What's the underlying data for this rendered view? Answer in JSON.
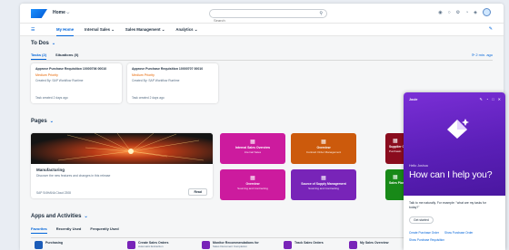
{
  "shell": {
    "title": "Home",
    "search_placeholder": "Search",
    "search_icon": "search-icon",
    "icons": [
      "notification-icon",
      "help-icon",
      "settings-icon",
      "history-icon",
      "joule-icon"
    ]
  },
  "nav": {
    "menu_icon": "menu-icon",
    "tabs": [
      {
        "label": "My Home",
        "active": true
      },
      {
        "label": "Internal Sales"
      },
      {
        "label": "Sales Management"
      },
      {
        "label": "Analytics"
      }
    ]
  },
  "todos": {
    "title": "To Dos",
    "tabs": [
      {
        "label": "Tasks (2)",
        "active": true
      },
      {
        "label": "Situations (0)"
      }
    ],
    "updated": "2 min. ago",
    "cards": [
      {
        "title": "Approve Purchase Requisition 10000706 00010",
        "priority": "Medium Priority",
        "created": "Created By: SAP Workflow Runtime",
        "date": "Task created 2 days ago"
      },
      {
        "title": "Approve Purchase Requisition 10000707 00010",
        "priority": "Medium Priority",
        "created": "Created By: SAP Workflow Runtime",
        "date": "Task created 2 days ago"
      }
    ]
  },
  "pages": {
    "title": "Pages",
    "manufacturing": {
      "title": "Manufacturing",
      "subtitle": "Discover the new features and changes in this release",
      "footer": "SAP S/4HANA Cloud 2308",
      "button": "Read"
    },
    "tiles": [
      {
        "name": "Internal Sales Overview",
        "sub": "Internal Sales",
        "color": "#cc1b9e"
      },
      {
        "name": "Overview",
        "sub": "Contract Order Management",
        "color": "#cc5a0c"
      },
      {
        "name": "Overview",
        "sub": "Sourcing and Contracting",
        "color": "#cc1b9e"
      },
      {
        "name": "Source of Supply Management",
        "sub": "Sourcing and Contracting",
        "color": "#7824b8"
      }
    ],
    "partial_tiles": [
      {
        "name": "Supplier Overv",
        "sub": "Purchasin",
        "color": "#8a0c1e"
      },
      {
        "name": "Sales Plannin",
        "sub": "",
        "color": "#188918"
      }
    ]
  },
  "apps": {
    "title": "Apps and Activities",
    "tabs": [
      {
        "label": "Favorites",
        "active": true
      },
      {
        "label": "Recently Used"
      },
      {
        "label": "Frequently Used"
      }
    ],
    "items": [
      {
        "label": "Purchasing",
        "sub": "",
        "color": "#1b5cb8"
      },
      {
        "label": "Create Sales Orders",
        "sub": "Automatic Extraction",
        "color": "#7824b8"
      },
      {
        "label": "Monitor Recommendations for",
        "sub": "Sales Document Completion",
        "color": "#7824b8"
      },
      {
        "label": "Track Sales Orders",
        "sub": "",
        "color": "#7824b8"
      },
      {
        "label": "My Sales Overview",
        "sub": "",
        "color": "#7824b8"
      }
    ]
  },
  "joule": {
    "title": "Joule",
    "hello": "Hello Joshua",
    "help": "How can I help you?",
    "question": "Talk to me naturally. For example: \"what are my tasks for today?\"",
    "start": "Get started",
    "suggestions": [
      "Create Purchase Order",
      "Show Purchase Order",
      "Show Purchase Requisition"
    ]
  }
}
